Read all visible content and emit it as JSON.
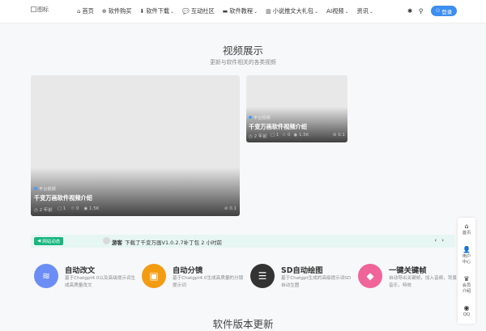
{
  "header": {
    "logo_alt": "图标",
    "nav": [
      {
        "icon": "home-icon",
        "glyph": "⌂",
        "label": "首页",
        "dropdown": false
      },
      {
        "icon": "cart-icon",
        "glyph": "⊕",
        "label": "软件购买",
        "dropdown": false
      },
      {
        "icon": "download-icon",
        "glyph": "⬇",
        "label": "软件下载",
        "dropdown": true
      },
      {
        "icon": "comments-icon",
        "glyph": "💬",
        "label": "互动社区",
        "dropdown": false
      },
      {
        "icon": "tv-icon",
        "glyph": "▬",
        "label": "软件教程",
        "dropdown": true
      },
      {
        "icon": "building-icon",
        "glyph": "▥",
        "label": "小说推文大礼包",
        "dropdown": true
      },
      {
        "icon": "",
        "glyph": "",
        "label": "AI视频",
        "dropdown": true
      },
      {
        "icon": "",
        "glyph": "",
        "label": "资讯",
        "dropdown": true
      }
    ],
    "login_label": "登录"
  },
  "video_section": {
    "title": "视频展示",
    "subtitle": "更新与软件相关的各类视频"
  },
  "cards": [
    {
      "tag": "平台视频",
      "title": "千变万画软件视频介绍",
      "date": "2 年前",
      "comments": "1",
      "likes": "0",
      "views": "1.5K",
      "count": "0.1"
    },
    {
      "tag": "平台视频",
      "title": "千变万画软件视频介绍",
      "date": "2 年前",
      "comments": "1",
      "likes": "0",
      "views": "1.5K",
      "count": "0.1"
    }
  ],
  "ticker": {
    "badge": "网站动态",
    "user": "游客",
    "message": "下载了千变万画V1.0.2.7补丁包",
    "time": "2 小时前"
  },
  "features": [
    {
      "name": "自动改文",
      "desc": "基于Chatgpt4.0以及高级提示词生成高质量改文",
      "color": "#6b8df5",
      "icon": "layers-icon",
      "glyph": "≋"
    },
    {
      "name": "自动分镜",
      "desc": "基于Chatgpt4.0生成高质量的分镜提示词",
      "color": "#f39c12",
      "icon": "shopping-bag-icon",
      "glyph": "▣"
    },
    {
      "name": "SD自动绘图",
      "desc": "基于Chatgpt生成的高级提示词SD自动生图",
      "color": "#333333",
      "icon": "list-icon",
      "glyph": "☰"
    },
    {
      "name": "一键关键帧",
      "desc": "自动导出关键帧，加入音频，背景音乐，特效",
      "color": "#f0649a",
      "icon": "diamond-icon",
      "glyph": "◆"
    }
  ],
  "next_section_title": "软件版本更新",
  "sidebar": [
    {
      "icon": "home-icon",
      "glyph": "⌂",
      "label": "首页"
    },
    {
      "icon": "user-icon",
      "glyph": "👤",
      "label": "用户中心"
    },
    {
      "icon": "crown-icon",
      "glyph": "♛",
      "label": "会员介绍"
    },
    {
      "icon": "qq-icon",
      "glyph": "◉",
      "label": "QQ"
    }
  ]
}
